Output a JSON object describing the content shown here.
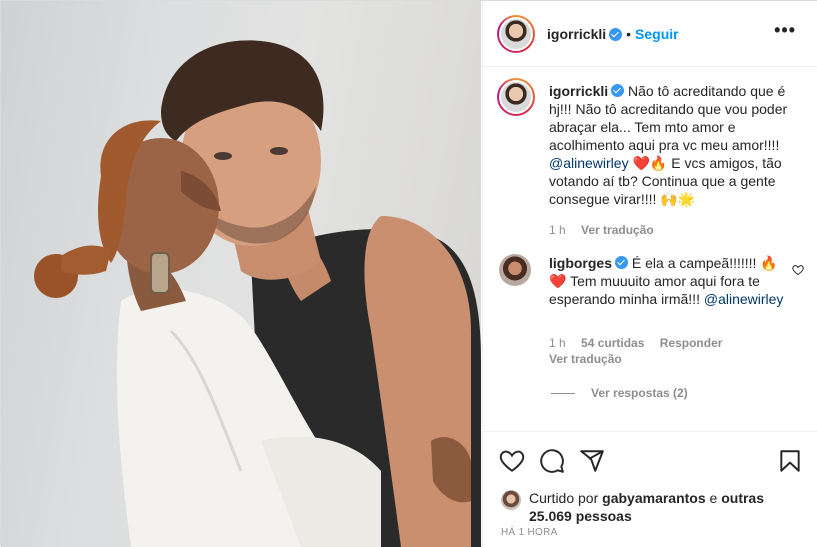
{
  "post": {
    "author": "igorrickli",
    "follow_label": "Seguir",
    "separator": "•",
    "more_label": "•••"
  },
  "caption": {
    "author": "igorrickli",
    "line1": " Não tô acreditando que é hj!!! Não tô acreditando que vou poder abraçar ela... Tem mto amor e acolhimento aqui pra vc meu amor!!!! ",
    "mention": "@alinewirley",
    "line2": " ❤️🔥 E vcs amigos, tão votando aí tb? Continua que a gente consegue virar!!!! 🙌🌟",
    "time": "1 h",
    "translate": "Ver tradução"
  },
  "comment": {
    "author": "ligborges",
    "text1": " É ela a campeã!!!!!!! 🔥❤️ Tem muuuito amor aqui fora te esperando minha irmã!!! ",
    "mention": "@alinewirley",
    "time": "1 h",
    "likes": "54 curtidas",
    "reply": "Responder",
    "translate": "Ver tradução",
    "view_replies": "Ver respostas (2)"
  },
  "likes": {
    "prefix": "Curtido por ",
    "user": "gabyamarantos",
    "middle": " e ",
    "others": "outras 25.069 pessoas"
  },
  "time_ago": "HÁ 1 HORA",
  "icons": [
    "heart-icon",
    "comment-icon",
    "share-icon",
    "bookmark-icon",
    "more-icon",
    "verified-icon"
  ],
  "colors": {
    "link": "#0095f6",
    "mention": "#00376b",
    "muted": "#8e8e8e",
    "verified": "#3897f0"
  }
}
